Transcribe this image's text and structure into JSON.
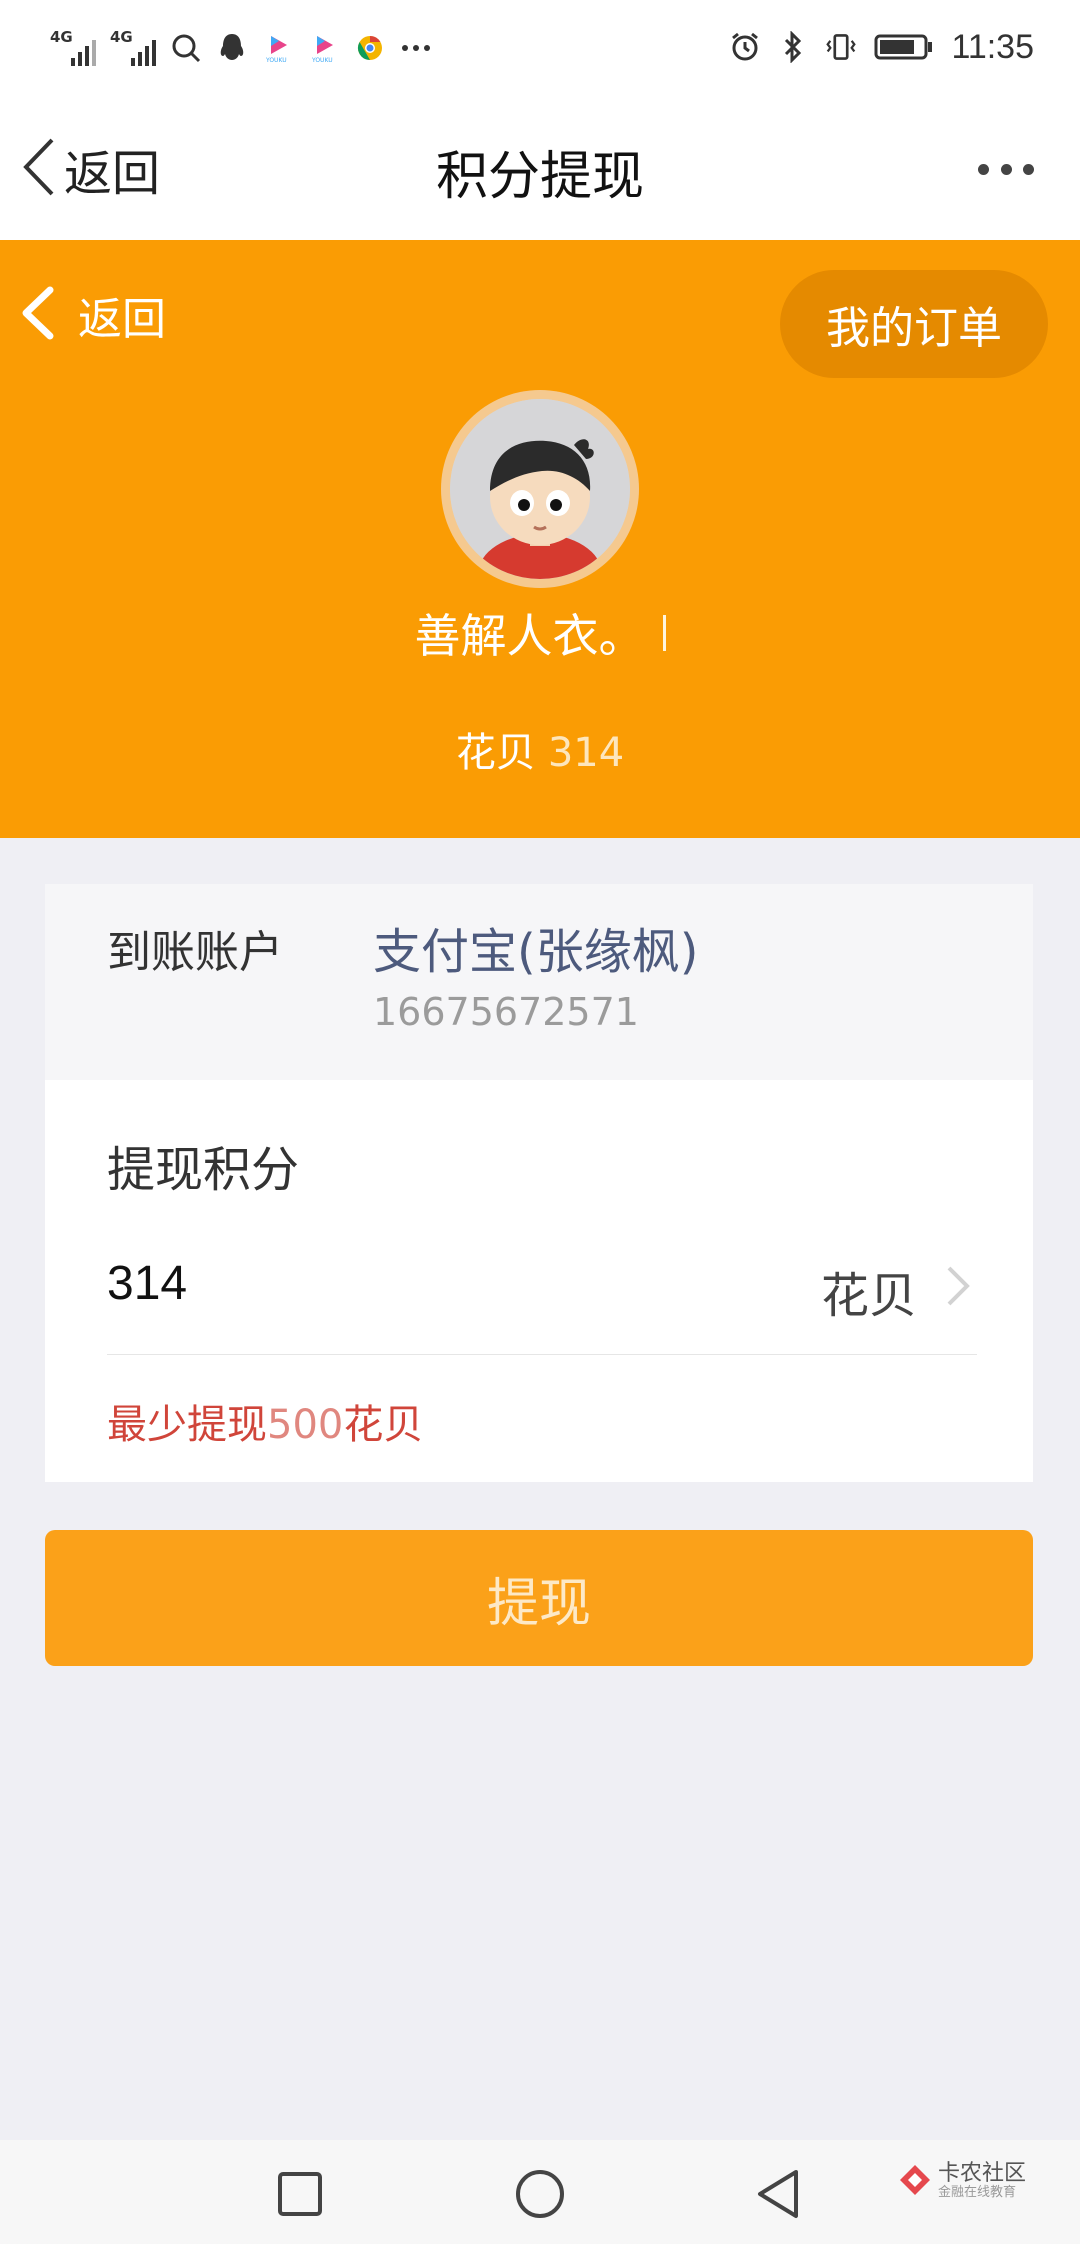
{
  "status_bar": {
    "signal_1_label": "4G",
    "signal_2_label": "4G",
    "time": "11:35",
    "icons": [
      "search-icon",
      "qq-icon",
      "youku-icon",
      "youku-icon",
      "chrome-icon",
      "more-dots-icon",
      "alarm-icon",
      "bluetooth-icon",
      "vibrate-icon",
      "battery-icon"
    ]
  },
  "nav": {
    "back_label": "返回",
    "title": "积分提现"
  },
  "hero": {
    "back_label": "返回",
    "my_orders": "我的订单",
    "username": "善解人衣。",
    "points_label": "花贝",
    "points_value": "314"
  },
  "account": {
    "label": "到账账户",
    "name": "支付宝(张缘枫)",
    "phone": "16675672571"
  },
  "withdraw": {
    "label": "提现积分",
    "amount": "314",
    "unit": "花贝",
    "hint_prefix": "最少提现",
    "hint_number": "500",
    "hint_suffix": "花贝",
    "submit_label": "提现"
  },
  "watermark": {
    "title": "卡农社区",
    "subtitle": "金融在线教育"
  },
  "colors": {
    "brand_orange": "#fa9c04",
    "button_orange": "#fba119",
    "hint_red": "#d0453a",
    "account_blue": "#4d5a7d"
  }
}
